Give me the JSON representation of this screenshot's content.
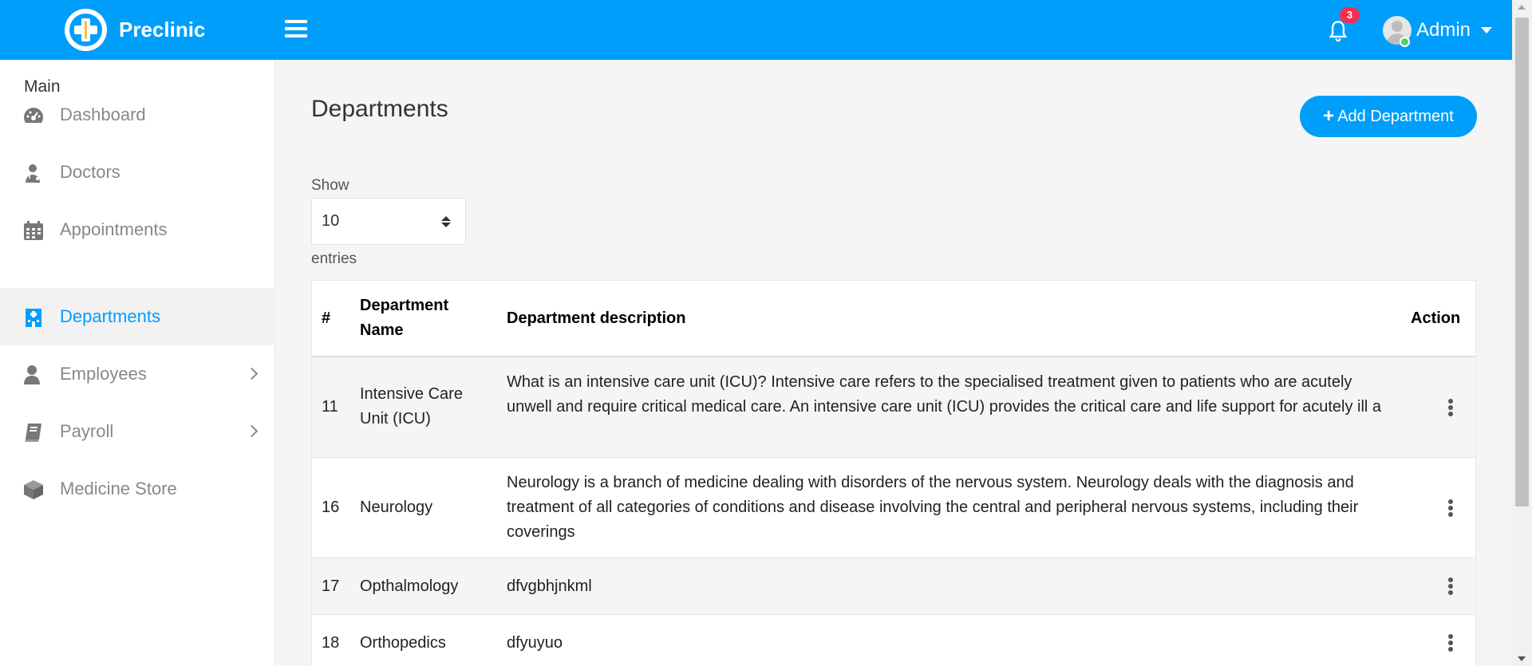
{
  "brand": {
    "name": "Preclinic"
  },
  "header": {
    "notification_count": "3",
    "user_name": "Admin"
  },
  "sidebar": {
    "title": "Main",
    "items": [
      {
        "label": "Dashboard",
        "icon": "dashboard-icon"
      },
      {
        "label": "Doctors",
        "icon": "doctor-icon"
      },
      {
        "label": "Appointments",
        "icon": "calendar-icon"
      },
      {
        "label": "Departments",
        "icon": "hospital-icon",
        "active": true
      },
      {
        "label": "Employees",
        "icon": "user-icon",
        "submenu": true
      },
      {
        "label": "Payroll",
        "icon": "book-icon",
        "submenu": true
      },
      {
        "label": "Medicine Store",
        "icon": "cube-icon"
      }
    ]
  },
  "main": {
    "title": "Departments",
    "add_button": "Add Department",
    "show_label": "Show",
    "entries_value": "10",
    "entries_label": "entries",
    "table": {
      "columns": [
        "#",
        "Department Name",
        "Department description",
        "Action"
      ],
      "rows": [
        {
          "id": "11",
          "name": "Intensive Care Unit (ICU)",
          "description": "What is an intensive care unit (ICU)? Intensive care refers to the specialised treatment given to patients who are acutely unwell and require critical medical care. An intensive care unit (ICU) provides the critical care and life support for acutely ill a"
        },
        {
          "id": "16",
          "name": "Neurology",
          "description": "Neurology is a branch of medicine dealing with disorders of the nervous system. Neurology deals with the diagnosis and treatment of all categories of conditions and disease involving the central and peripheral nervous systems, including their coverings"
        },
        {
          "id": "17",
          "name": "Opthalmology",
          "description": "dfvgbhjnkml"
        },
        {
          "id": "18",
          "name": "Orthopedics",
          "description": "dfyuyuo"
        }
      ]
    }
  },
  "colors": {
    "primary": "#009efb",
    "badge": "#f62d51",
    "online": "#55ce63"
  }
}
